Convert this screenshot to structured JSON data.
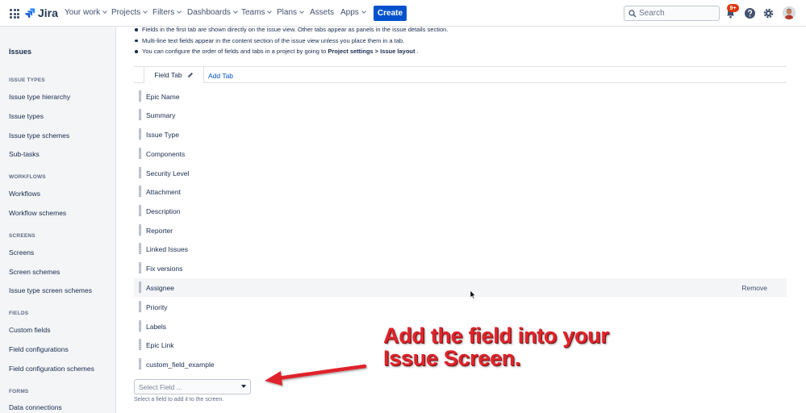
{
  "app": {
    "logo_text": "Jira"
  },
  "nav": {
    "items": [
      {
        "label": "Your work"
      },
      {
        "label": "Projects"
      },
      {
        "label": "Filters"
      },
      {
        "label": "Dashboards"
      },
      {
        "label": "Teams"
      },
      {
        "label": "Plans"
      },
      {
        "label": "Assets"
      },
      {
        "label": "Apps"
      }
    ],
    "create_label": "Create",
    "search_placeholder": "Search",
    "notification_badge": "9+"
  },
  "sidebar": {
    "title": "Issues",
    "sections": [
      {
        "heading": "ISSUE TYPES",
        "items": [
          "Issue type hierarchy",
          "Issue types",
          "Issue type schemes",
          "Sub-tasks"
        ]
      },
      {
        "heading": "WORKFLOWS",
        "items": [
          "Workflows",
          "Workflow schemes"
        ]
      },
      {
        "heading": "SCREENS",
        "items": [
          "Screens",
          "Screen schemes",
          "Issue type screen schemes"
        ]
      },
      {
        "heading": "FIELDS",
        "items": [
          "Custom fields",
          "Field configurations",
          "Field configuration schemes"
        ]
      },
      {
        "heading": "FORMS",
        "items": [
          "Data connections"
        ]
      }
    ]
  },
  "main": {
    "info": {
      "line1": "Fields in the first tab are shown directly on the issue view. Other tabs appear as panels in the issue details section.",
      "line2": "Multi-line text fields appear in the content section of the issue view unless you place them in a tab.",
      "line3_prefix": "You can configure the order of fields and tabs in a project by going to",
      "line3_bold": "Project settings > Issue layout",
      "line3_suffix": "."
    },
    "tabs": {
      "active": "Field Tab",
      "add": "Add Tab"
    },
    "fields": [
      "Epic Name",
      "Summary",
      "Issue Type",
      "Components",
      "Security Level",
      "Attachment",
      "Description",
      "Reporter",
      "Linked Issues",
      "Fix versions",
      "Assignee",
      "Priority",
      "Labels",
      "Epic Link",
      "custom_field_example"
    ],
    "remove_label": "Remove",
    "select_placeholder": "Select Field ...",
    "select_help": "Select a field to add it to the screen."
  },
  "annotation": {
    "line1": "Add the field into your",
    "line2": "Issue Screen."
  },
  "colors": {
    "accent": "#0052cc",
    "annotation": "#e0242c",
    "badge": "#de350b"
  }
}
